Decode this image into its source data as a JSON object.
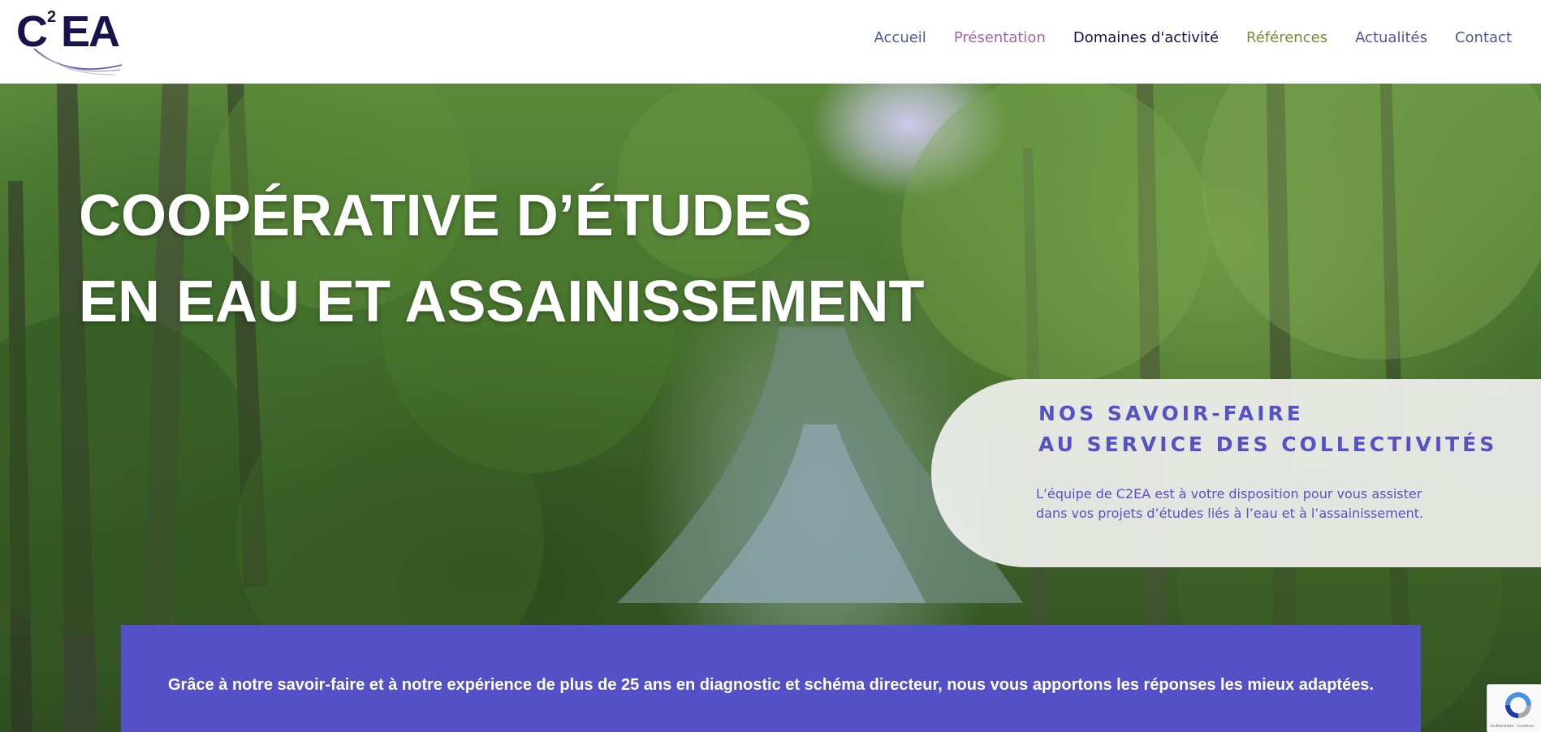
{
  "logo": {
    "text": "C",
    "text_rest": "EA",
    "superscript": "2",
    "alt": "C2EA"
  },
  "nav": {
    "items": [
      {
        "label": "Accueil",
        "color": "#4b5a93"
      },
      {
        "label": "Présentation",
        "color": "#a864a6"
      },
      {
        "label": "Domaines d'activité",
        "color": "#17134d"
      },
      {
        "label": "Références",
        "color": "#7a8a3a"
      },
      {
        "label": "Actualités",
        "color": "#5452a8"
      },
      {
        "label": "Contact",
        "color": "#4b5a93"
      }
    ]
  },
  "hero": {
    "title_line1": "COOPÉRATIVE D’ÉTUDES",
    "title_line2": "EN EAU ET ASSAINISSEMENT"
  },
  "card": {
    "heading_line1": "NOS SAVOIR-FAIRE",
    "heading_line2": "AU SERVICE DES COLLECTIVITÉS",
    "text": "L’équipe de C2EA est à votre disposition pour vous assister dans vos projets d’études liés à l’eau et à l’assainissement."
  },
  "banner": {
    "text": "Grâce à notre savoir-faire et à notre expérience de plus de 25 ans en diagnostic et schéma directeur, nous vous apportons les réponses les mieux adaptées."
  },
  "recaptcha": {
    "text": "Confidentialité - Conditions"
  },
  "colors": {
    "brand_dark": "#17134d",
    "accent_purple": "#5450c6",
    "card_text": "#5552c6"
  }
}
